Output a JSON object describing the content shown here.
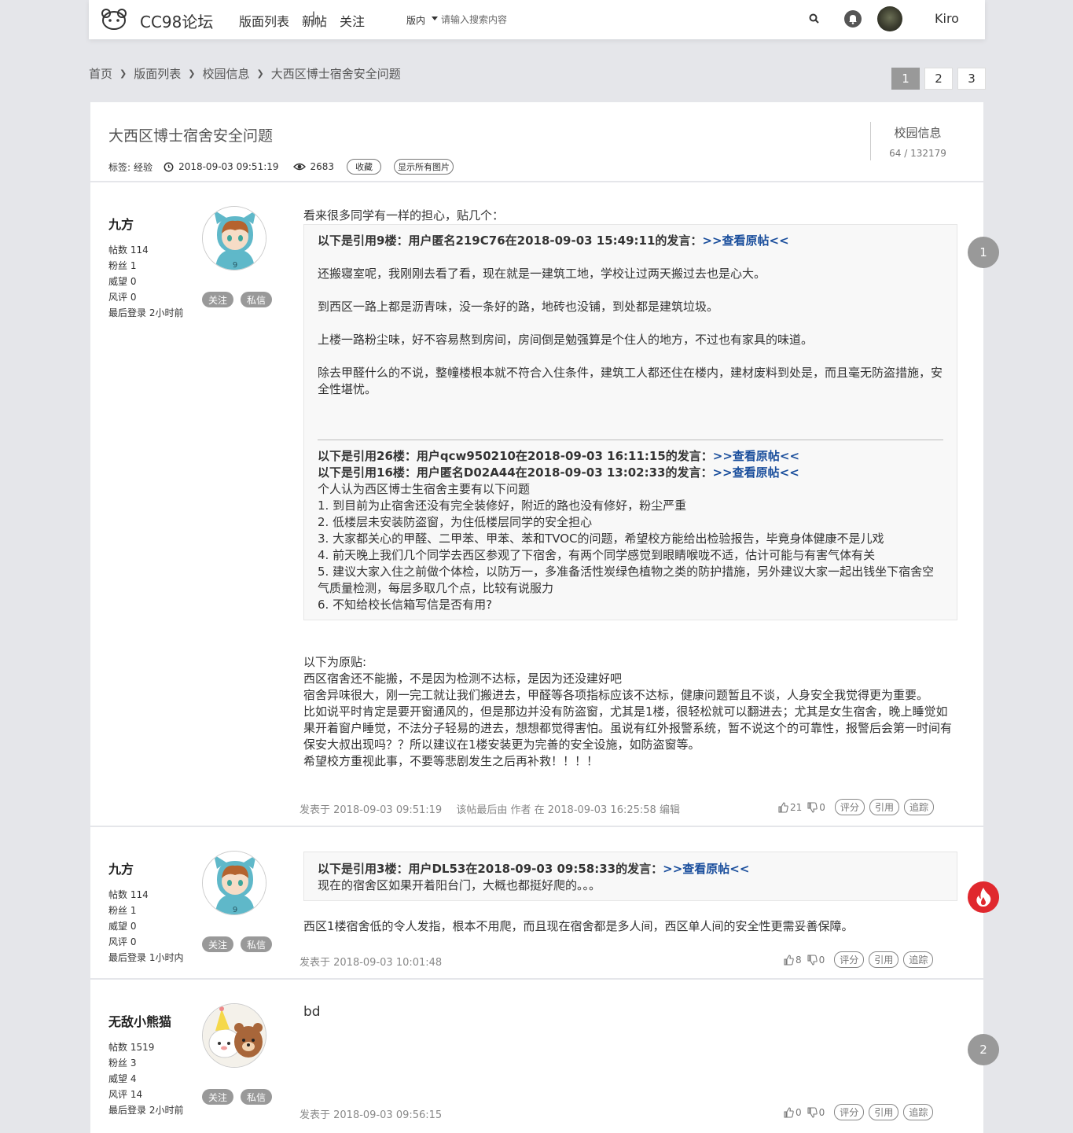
{
  "header": {
    "brand": "CC98论坛",
    "separator": "|",
    "nav": [
      "版面列表",
      "新帖",
      "关注"
    ],
    "search_scope": "版内",
    "search_placeholder": "请输入搜索内容",
    "username": "Kiro"
  },
  "breadcrumb": {
    "items": [
      "首页",
      "版面列表",
      "校园信息"
    ],
    "current": "大西区博士宿舍安全问题"
  },
  "pagination": {
    "pages": [
      "1",
      "2",
      "3"
    ],
    "active": "1"
  },
  "topic": {
    "title": "大西区博士宿舍安全问题",
    "tag_label": "标签:",
    "tag": "经验",
    "time": "2018-09-03 09:51:19",
    "views": "2683",
    "favorite_label": "收藏",
    "show_images_label": "显示所有图片",
    "board_name": "校园信息",
    "board_stats": "64 / 132179"
  },
  "common": {
    "follow": "关注",
    "message": "私信",
    "rate": "评分",
    "quote": "引用",
    "trace": "追踪"
  },
  "posts": [
    {
      "floor": "1",
      "user": "九方",
      "stats": [
        "帖数 114",
        "粉丝 1",
        "威望 0",
        "风评 0",
        "最后登录 2小时前"
      ],
      "intro": "看来很多同学有一样的担心，贴几个：",
      "quote1_head": "以下是引用9楼：用户匿名219C76在2018-09-03 15:49:11的发言：",
      "link": ">>查看原帖<<",
      "quote1_paras": [
        "还搬寝室呢，我刚刚去看了看，现在就是一建筑工地，学校让过两天搬过去也是心大。",
        "到西区一路上都是沥青味，没一条好的路，地砖也没铺，到处都是建筑垃圾。",
        "上楼一路粉尘味，好不容易熬到房间，房间倒是勉强算是个住人的地方，不过也有家具的味道。",
        "除去甲醛什么的不说，整幢楼根本就不符合入住条件，建筑工人都还住在楼内，建材废料到处是，而且毫无防盗措施，安全性堪忧。"
      ],
      "quote2_head": "以下是引用26楼：用户qcw950210在2018-09-03 16:11:15的发言：",
      "quote3_head": "以下是引用16楼：用户匿名D02A44在2018-09-03 13:02:33的发言：",
      "quote3_lines": [
        "个人认为西区博士生宿舍主要有以下问题",
        "1. 到目前为止宿舍还没有完全装修好，附近的路也没有修好，粉尘严重",
        "2. 低楼层未安装防盗窗，为住低楼层同学的安全担心",
        "3. 大家都关心的甲醛、二甲苯、甲苯、苯和TVOC的问题，希望校方能给出检验报告，毕竟身体健康不是儿戏",
        "4. 前天晚上我们几个同学去西区参观了下宿舍，有两个同学感觉到眼睛喉咙不适，估计可能与有害气体有关",
        "5. 建议大家入住之前做个体检，以防万一，多准备活性炭绿色植物之类的防护措施，另外建议大家一起出钱坐下宿舍空气质量检测，每层多取几个点，比较有说服力",
        "6. 不知给校长信箱写信是否有用?"
      ],
      "original_lines": [
        "以下为原贴:",
        "西区宿舍还不能搬，不是因为检测不达标，是因为还没建好吧",
        "宿舍异味很大，刚一完工就让我们搬进去，甲醛等各项指标应该不达标，健康问题暂且不谈，人身安全我觉得更为重要。",
        "比如说平时肯定是要开窗通风的，但是那边并没有防盗窗，尤其是1楼，很轻松就可以翻进去；尤其是女生宿舍，晚上睡觉如果开着窗户睡觉，不法分子轻易的进去，想想都觉得害怕。虽说有红外报警系统，暂不说这个的可靠性，报警后会第一时间有保安大叔出现吗？？所以建议在1楼安装更为完善的安全设施，如防盗窗等。",
        "希望校方重视此事，不要等悲剧发生之后再补救！！！！"
      ],
      "posted": "发表于 2018-09-03 09:51:19",
      "edited": "该帖最后由 作者 在 2018-09-03 16:25:58 编辑",
      "likes": "21",
      "dislikes": "0"
    },
    {
      "user": "九方",
      "stats": [
        "帖数 114",
        "粉丝 1",
        "威望 0",
        "风评 0",
        "最后登录 1小时内"
      ],
      "quote_head": "以下是引用3楼：用户DL53在2018-09-03 09:58:33的发言：",
      "quote_body": "现在的宿舍区如果开着阳台门，大概也都挺好爬的。。。",
      "body": "西区1楼宿舍低的令人发指，根本不用爬，而且现在宿舍都是多人间，西区单人间的安全性更需妥善保障。",
      "posted": "发表于 2018-09-03 10:01:48",
      "likes": "8",
      "dislikes": "0"
    },
    {
      "floor": "2",
      "user": "无敌小熊猫",
      "stats": [
        "帖数 1519",
        "粉丝 3",
        "威望 4",
        "风评 14",
        "最后登录 2小时前"
      ],
      "body": "bd",
      "posted": "发表于 2018-09-03 09:56:15",
      "likes": "0",
      "dislikes": "0"
    }
  ],
  "colors": {
    "background": "#e5e6ea",
    "link": "#1a4e9c",
    "badge": "#999999",
    "hot": "#e0282e"
  }
}
